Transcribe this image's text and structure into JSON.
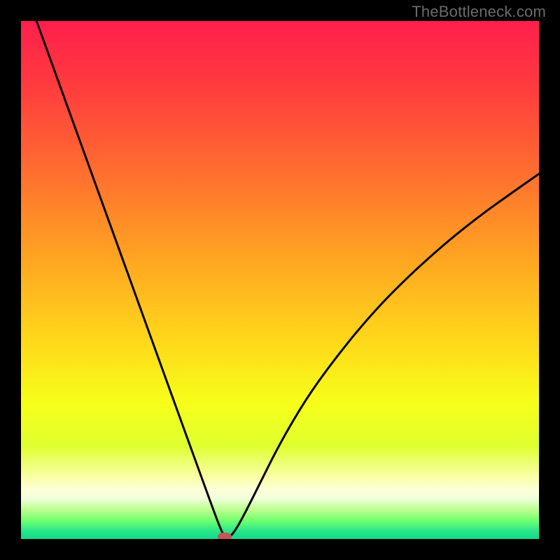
{
  "watermark": "TheBottleneck.com",
  "chart_data": {
    "type": "line",
    "title": "",
    "xlabel": "",
    "ylabel": "",
    "xlim": [
      0,
      100
    ],
    "ylim": [
      0,
      100
    ],
    "grid": false,
    "legend": false,
    "note": "Bottleneck-style V curve on red→green vertical gradient; minimum near x≈39.",
    "series": [
      {
        "name": "bottleneck-curve",
        "x": [
          3.0,
          6.0,
          9.0,
          12.0,
          15.0,
          18.0,
          21.0,
          24.0,
          27.0,
          30.0,
          33.0,
          35.0,
          37.0,
          38.5,
          39.3,
          40.0,
          41.5,
          43.5,
          46.0,
          50.0,
          55.0,
          60.0,
          66.0,
          72.0,
          80.0,
          88.0,
          95.0,
          100.0
        ],
        "values": [
          100.0,
          91.7,
          83.4,
          75.1,
          66.8,
          58.5,
          50.2,
          41.9,
          33.6,
          25.3,
          17.0,
          11.5,
          6.0,
          2.0,
          0.4,
          0.0,
          1.8,
          5.5,
          10.5,
          18.5,
          27.0,
          34.0,
          41.5,
          48.0,
          55.5,
          62.0,
          67.0,
          70.5
        ]
      }
    ],
    "marker": {
      "x": 39.3,
      "y": 0.4,
      "color": "#c05858"
    },
    "gradient_stops": [
      {
        "pos": 0.0,
        "color": "#ff1f4c"
      },
      {
        "pos": 0.12,
        "color": "#ff3a3f"
      },
      {
        "pos": 0.28,
        "color": "#ff6a30"
      },
      {
        "pos": 0.45,
        "color": "#ffa222"
      },
      {
        "pos": 0.62,
        "color": "#ffd91a"
      },
      {
        "pos": 0.74,
        "color": "#f6ff1a"
      },
      {
        "pos": 0.82,
        "color": "#e0ff30"
      },
      {
        "pos": 0.885,
        "color": "#faffb0"
      },
      {
        "pos": 0.905,
        "color": "#fdffd8"
      },
      {
        "pos": 0.922,
        "color": "#f0ffda"
      },
      {
        "pos": 0.945,
        "color": "#b8ff8a"
      },
      {
        "pos": 0.965,
        "color": "#6eff70"
      },
      {
        "pos": 0.985,
        "color": "#28e58a"
      },
      {
        "pos": 1.0,
        "color": "#11d989"
      }
    ]
  }
}
